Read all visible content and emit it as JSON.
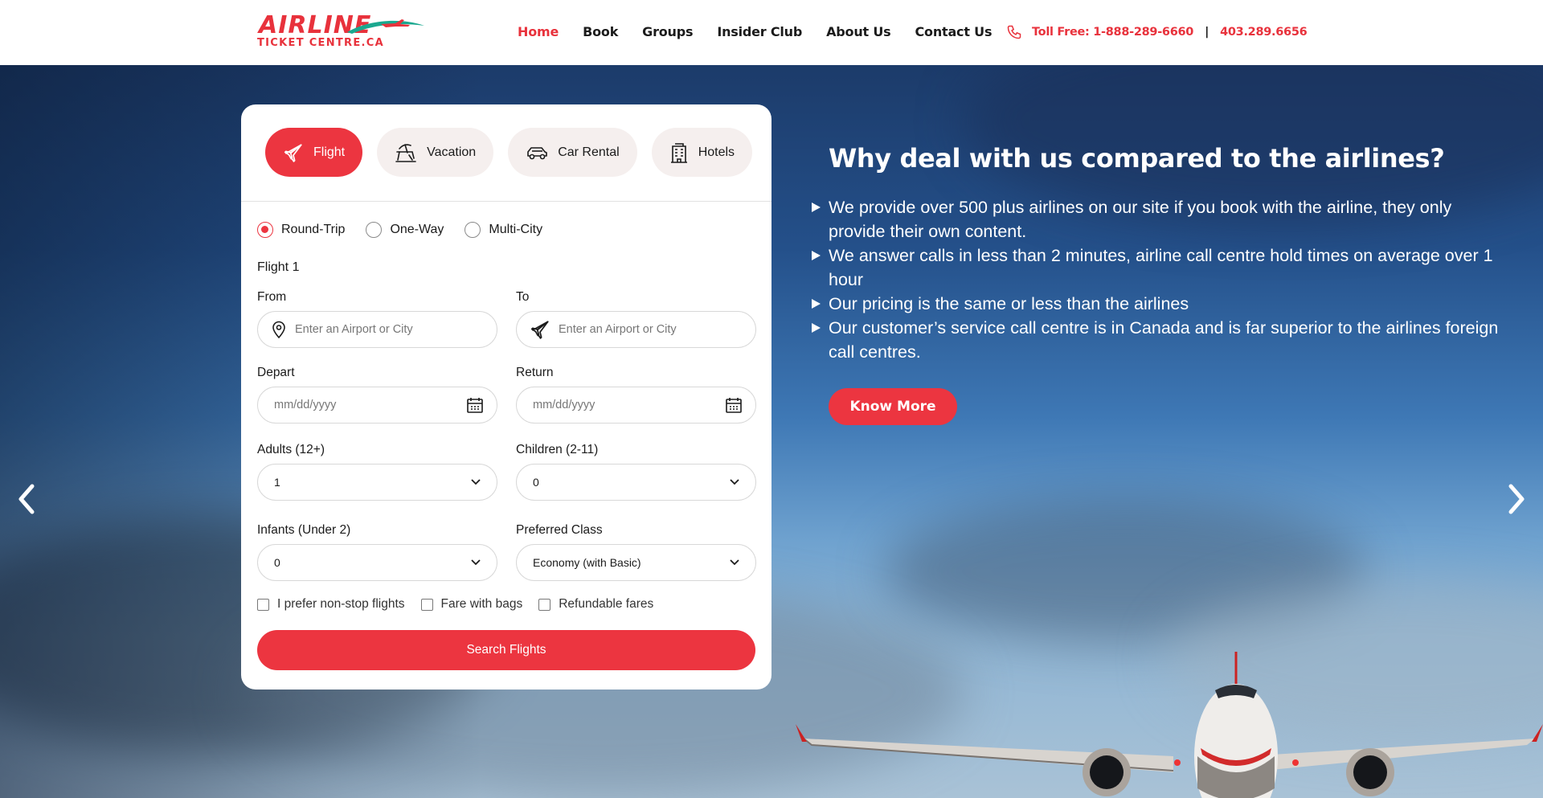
{
  "header": {
    "logo": {
      "line1": "AIRLINE",
      "line2": "TICKET CENTRE.CA"
    },
    "nav": [
      {
        "label": "Home",
        "active": true
      },
      {
        "label": "Book"
      },
      {
        "label": "Groups"
      },
      {
        "label": "Insider Club"
      },
      {
        "label": "About Us"
      },
      {
        "label": "Contact Us"
      }
    ],
    "phone": {
      "toll_free": "Toll Free: 1-888-289-6660",
      "separator": "|",
      "local": "403.289.6656",
      "icon": "phone-icon"
    }
  },
  "booking": {
    "tabs": [
      {
        "label": "Flight",
        "icon": "airplane-icon",
        "active": true
      },
      {
        "label": "Vacation",
        "icon": "beach-chair-icon"
      },
      {
        "label": "Car Rental",
        "icon": "car-icon"
      },
      {
        "label": "Hotels",
        "icon": "hotel-building-icon"
      }
    ],
    "trip_types": [
      {
        "label": "Round-Trip",
        "checked": true
      },
      {
        "label": "One-Way"
      },
      {
        "label": "Multi-City"
      }
    ],
    "section_title": "Flight 1",
    "from": {
      "label": "From",
      "placeholder": "Enter an Airport or City"
    },
    "to": {
      "label": "To",
      "placeholder": "Enter an Airport or City"
    },
    "depart": {
      "label": "Depart",
      "placeholder": "mm/dd/yyyy"
    },
    "return": {
      "label": "Return",
      "placeholder": "mm/dd/yyyy"
    },
    "adults": {
      "label": "Adults (12+)",
      "value": "1"
    },
    "children": {
      "label": "Children (2-11)",
      "value": "0"
    },
    "infants": {
      "label": "Infants (Under 2)",
      "value": "0"
    },
    "class": {
      "label": "Preferred Class",
      "value": "Economy (with Basic)"
    },
    "options": [
      {
        "label": "I prefer non-stop flights"
      },
      {
        "label": "Fare with bags"
      },
      {
        "label": "Refundable fares"
      }
    ],
    "search_label": "Search Flights"
  },
  "info": {
    "title": "Why deal with us compared to the airlines?",
    "bullets": [
      "We provide over 500 plus airlines on our site if you book with the airline, they only provide their own content.",
      "We answer calls in less than 2 minutes, airline call centre hold times on average over 1 hour",
      "Our pricing is the same or less than the airlines",
      "Our customer’s service call centre is in Canada and is far superior to the airlines foreign call centres."
    ],
    "button_label": "Know More"
  },
  "colors": {
    "accent": "#ec3540",
    "text": "#1b1b1b",
    "tab_bg": "#f5efee"
  }
}
